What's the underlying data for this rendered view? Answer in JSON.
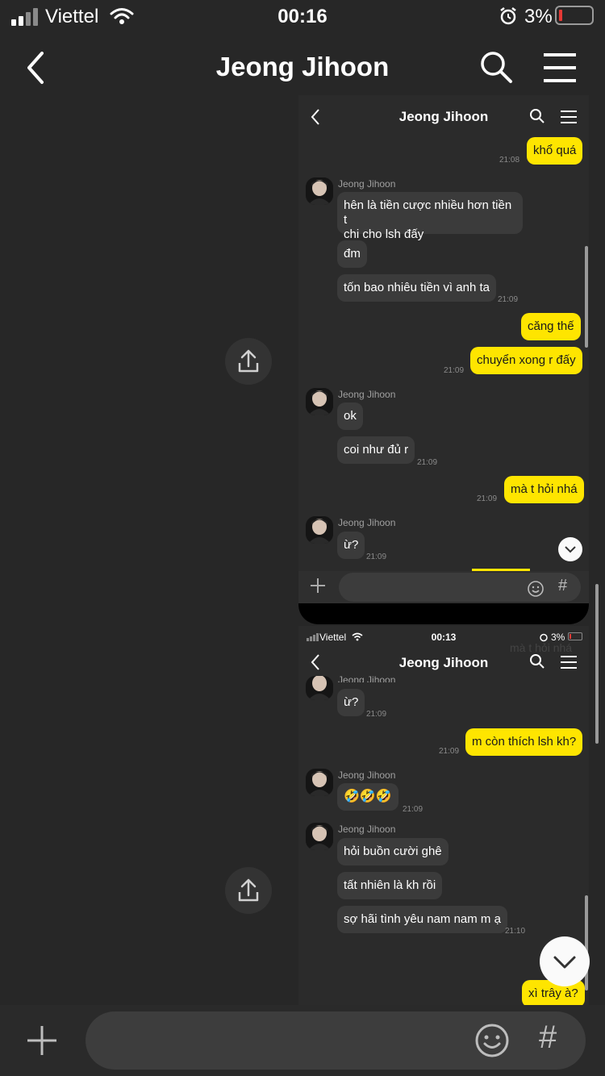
{
  "status_bar": {
    "carrier": "Viettel",
    "time": "00:16",
    "battery": "3%"
  },
  "header": {
    "title": "Jeong Jihoon"
  },
  "frame1": {
    "title": "Jeong Jihoon",
    "messages": [
      {
        "text": "khổ quá",
        "time": "21:08"
      },
      {
        "name": "Jeong Jihoon",
        "text": "hên là tiền cược nhiều hơn tiền t",
        "text2": "chi cho lsh đấy"
      },
      {
        "text": "đm"
      },
      {
        "text": "tốn bao nhiêu tiền vì anh ta",
        "time": "21:09"
      },
      {
        "text": "căng thế"
      },
      {
        "text": "chuyển xong r đấy",
        "time": "21:09"
      },
      {
        "name": "Jeong Jihoon",
        "text": "ok"
      },
      {
        "text": "coi như đủ r",
        "time": "21:09"
      },
      {
        "text": "mà t hỏi nhá",
        "time": "21:09"
      },
      {
        "name": "Jeong Jihoon",
        "text": "ừ?",
        "time": "21:09"
      }
    ]
  },
  "frame2": {
    "status": {
      "carrier": "Viettel",
      "time": "00:13",
      "battery": "3%"
    },
    "title": "Jeong Jihoon",
    "ghost_text": "mà t hỏi nhá",
    "messages": [
      {
        "name": "Jeong Jihoon",
        "text": "ừ?",
        "time": "21:09"
      },
      {
        "text": "m còn thích lsh kh?",
        "time": "21:09"
      },
      {
        "name": "Jeong Jihoon",
        "text": "🤣🤣🤣",
        "time": "21:09"
      },
      {
        "name": "Jeong Jihoon",
        "text": "hỏi buồn cười ghê"
      },
      {
        "text": "tất nhiên là kh rồi"
      },
      {
        "text": "sợ hãi tình yêu nam nam m ạ",
        "time": "21:10"
      },
      {
        "text": "xì trây à?"
      }
    ]
  },
  "icons": [
    "back-icon",
    "search-icon",
    "menu-icon",
    "share-icon",
    "chevron-down-icon",
    "plus-icon",
    "emoji-icon",
    "hashtag-icon"
  ],
  "input": {
    "hash": "#"
  },
  "colors": {
    "background": "#272727",
    "incoming_bubble": "#3b3b3b",
    "outgoing_bubble": "#fee500",
    "battery_low": "#e53935"
  }
}
